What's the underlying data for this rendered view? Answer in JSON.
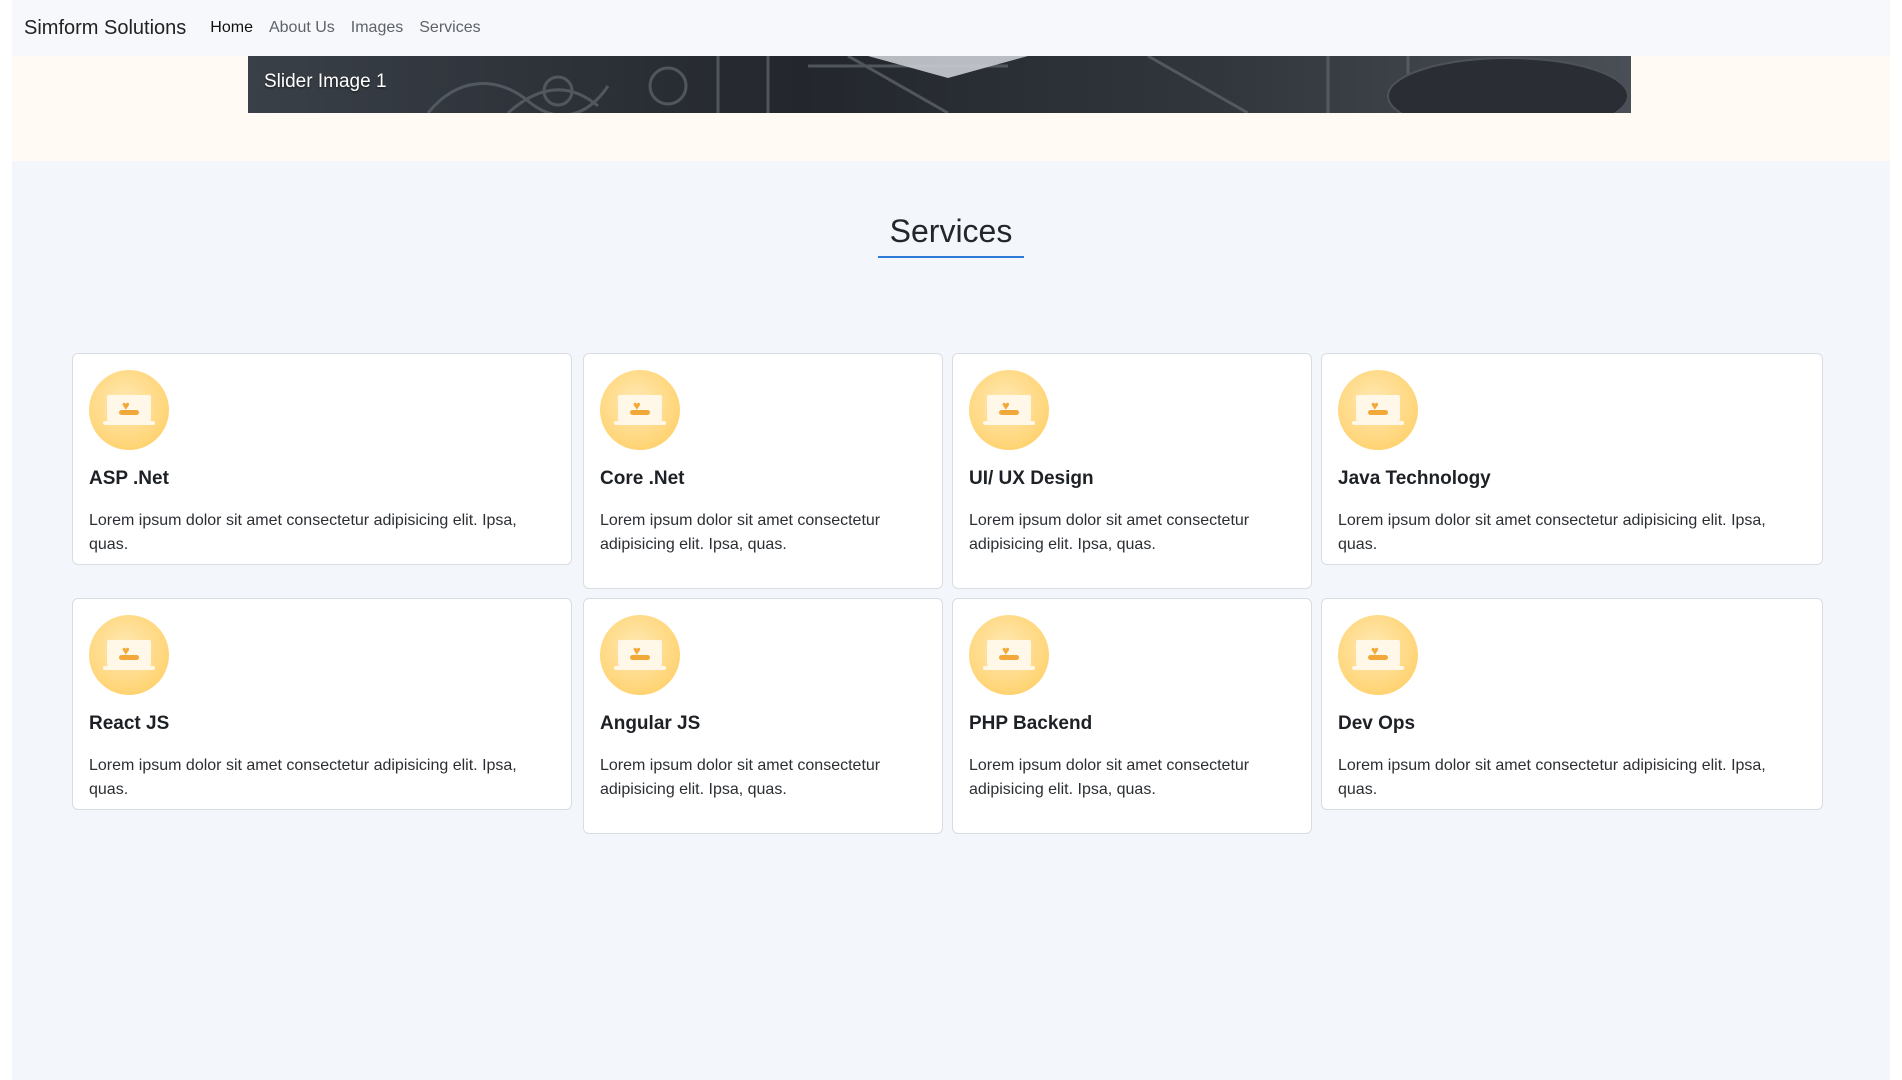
{
  "navbar": {
    "brand": "Simform Solutions",
    "links": [
      "Home",
      "About Us",
      "Images",
      "Services"
    ]
  },
  "hero": {
    "caption": "Slider Image 1"
  },
  "services": {
    "title": "Services",
    "icon_name": "laptop-heart-icon",
    "icon_colors": {
      "circle": "#ffd475",
      "accent": "#f3a93a"
    },
    "accent_color": "#2f7ad8",
    "cards": [
      {
        "title": "ASP .Net",
        "text": "Lorem ipsum dolor sit amet consectetur adipisicing elit. Ipsa, quas."
      },
      {
        "title": "Core .Net",
        "text": "Lorem ipsum dolor sit amet consectetur adipisicing elit. Ipsa, quas."
      },
      {
        "title": "UI/ UX Design",
        "text": "Lorem ipsum dolor sit amet consectetur adipisicing elit. Ipsa, quas."
      },
      {
        "title": "Java Technology",
        "text": "Lorem ipsum dolor sit amet consectetur adipisicing elit. Ipsa, quas."
      },
      {
        "title": "React JS",
        "text": "Lorem ipsum dolor sit amet consectetur adipisicing elit. Ipsa, quas."
      },
      {
        "title": "Angular JS",
        "text": "Lorem ipsum dolor sit amet consectetur adipisicing elit. Ipsa, quas."
      },
      {
        "title": "PHP Backend",
        "text": "Lorem ipsum dolor sit amet consectetur adipisicing elit. Ipsa, quas."
      },
      {
        "title": "Dev Ops",
        "text": "Lorem ipsum dolor sit amet consectetur adipisicing elit. Ipsa, quas."
      }
    ]
  }
}
